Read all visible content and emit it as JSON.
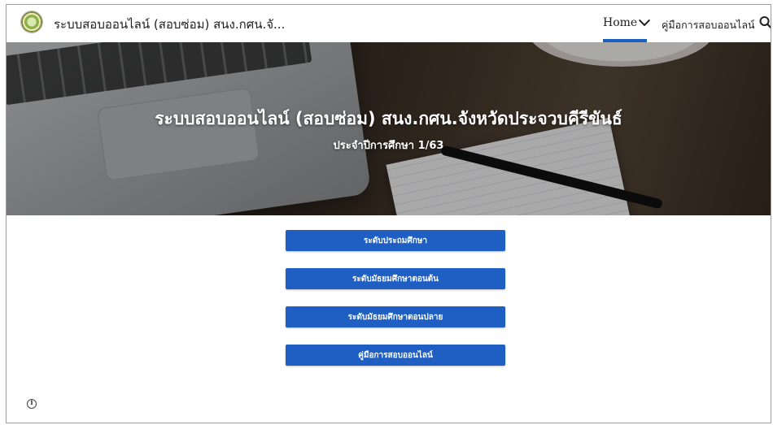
{
  "header": {
    "site_title": "ระบบสอบออนไลน์ (สอบซ่อม) สนง.กศน.จั...",
    "nav": {
      "home_label": "Home",
      "manual_label": "คู่มือการสอบออนไลน์"
    },
    "accent_color": "#1a5fc1"
  },
  "hero": {
    "title": "ระบบสอบออนไลน์ (สอบซ่อม) สนง.กศน.จังหวัดประจวบคีรีขันธ์",
    "subtitle": "ประจำปีการศึกษา 1/63"
  },
  "buttons": [
    {
      "label": "ระดับประถมศึกษา"
    },
    {
      "label": "ระดับมัธยมศึกษาตอนต้น"
    },
    {
      "label": "ระดับมัธยมศึกษาตอนปลาย"
    },
    {
      "label": "คู่มือการสอบออนไลน์"
    }
  ],
  "icons": {
    "logo": "site-logo",
    "search": "search-icon",
    "dropdown": "chevron-down-icon",
    "info": "info-icon"
  },
  "button_color": "#1f5fc4"
}
